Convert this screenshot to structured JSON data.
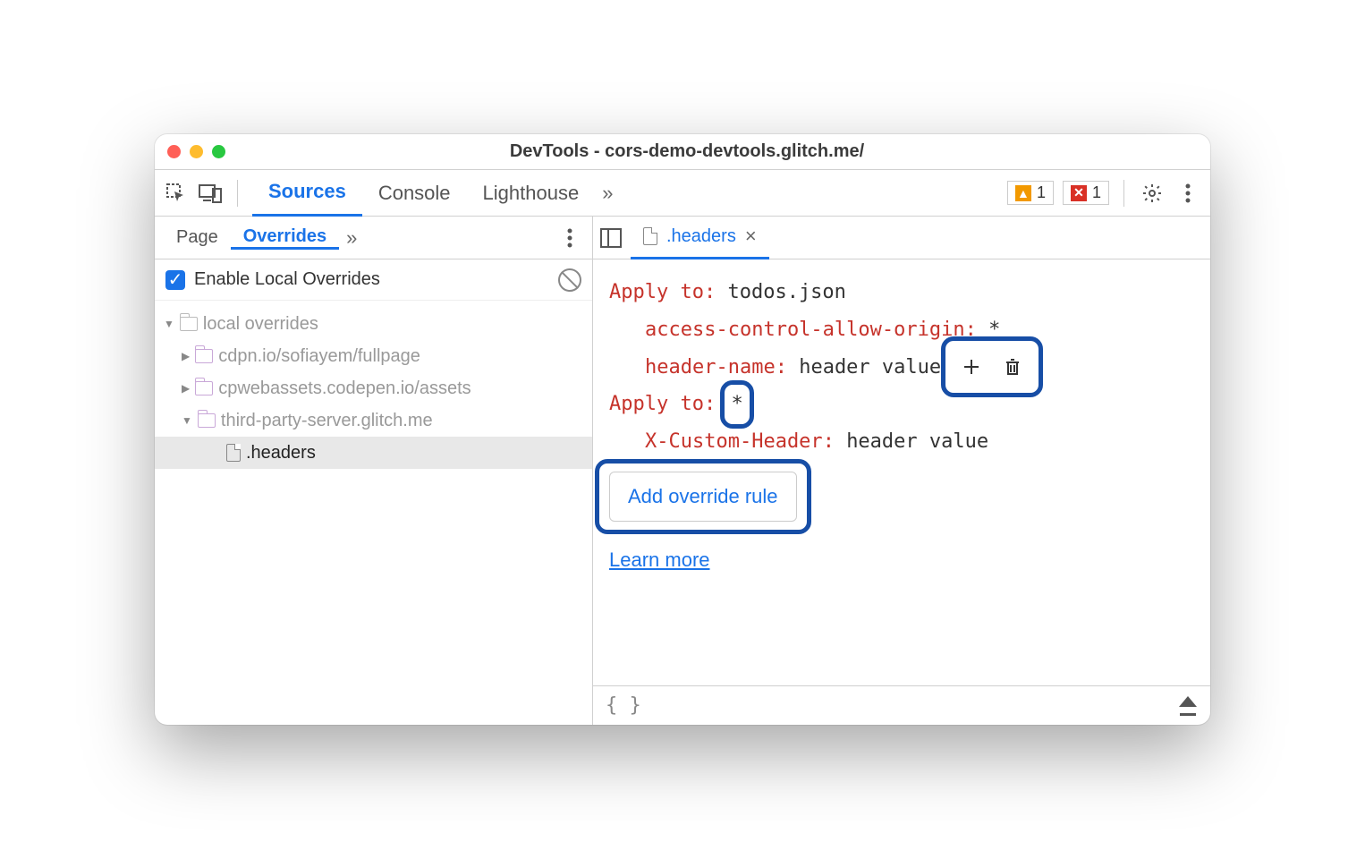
{
  "window": {
    "title": "DevTools - cors-demo-devtools.glitch.me/"
  },
  "toolbar": {
    "tabs": [
      "Sources",
      "Console",
      "Lighthouse"
    ],
    "active_tab": 0,
    "warnings": "1",
    "errors": "1"
  },
  "sidebar": {
    "tabs": [
      "Page",
      "Overrides"
    ],
    "active_tab": 1,
    "enable_label": "Enable Local Overrides",
    "tree": {
      "root": "local overrides",
      "children": [
        "cdpn.io/sofiayem/fullpage",
        "cpwebassets.codepen.io/assets",
        "third-party-server.glitch.me"
      ],
      "selected_file": ".headers"
    }
  },
  "editor": {
    "tab_name": ".headers",
    "rules": [
      {
        "apply_label": "Apply to",
        "target": "todos.json",
        "headers": [
          {
            "name": "access-control-allow-origin",
            "value": "*"
          },
          {
            "name": "header-name",
            "value": "header value"
          }
        ]
      },
      {
        "apply_label": "Apply to",
        "target": "*",
        "headers": [
          {
            "name": "X-Custom-Header",
            "value": "header value"
          }
        ]
      }
    ],
    "add_rule_label": "Add override rule",
    "learn_more_label": "Learn more"
  }
}
